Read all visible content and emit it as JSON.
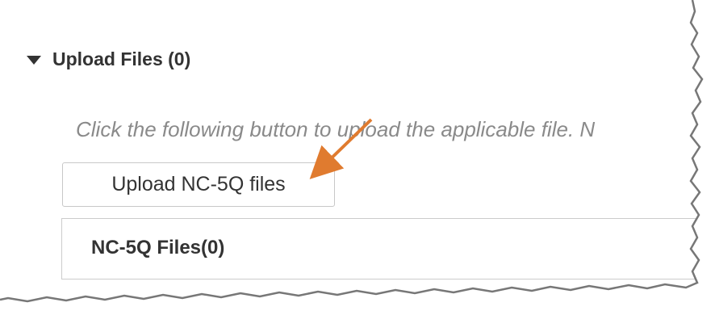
{
  "upload_section": {
    "title": "Upload Files (0)",
    "expand_icon": "caret-down-icon",
    "instruction": "Click the following button to upload the applicable file. N",
    "upload_button_label": "Upload NC-5Q files",
    "files_panel_title": "NC-5Q Files(0)"
  },
  "annotation": {
    "arrow_icon": "callout-arrow-icon",
    "arrow_color": "#e07b2f"
  }
}
